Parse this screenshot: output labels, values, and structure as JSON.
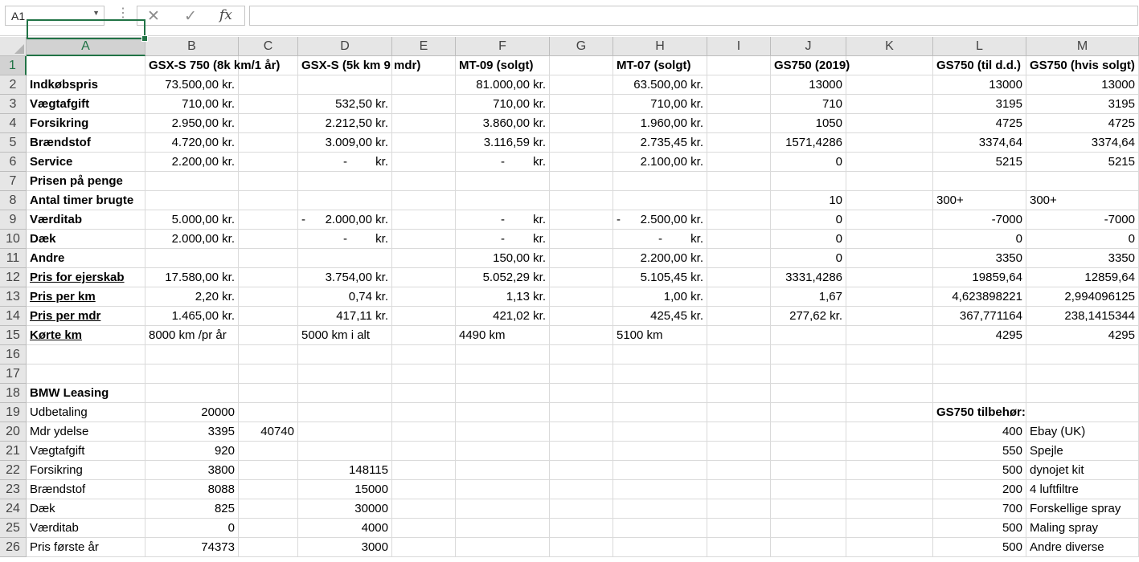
{
  "name_box": {
    "value": "A1",
    "dropdown_icon": "chevron-down-icon"
  },
  "formula_bar": {
    "cancel_icon": "✕",
    "enter_icon": "✓",
    "fx_label": "fx",
    "value": ""
  },
  "columns": [
    "A",
    "B",
    "C",
    "D",
    "E",
    "F",
    "G",
    "H",
    "I",
    "J",
    "K",
    "L",
    "M"
  ],
  "rows": [
    [
      "",
      "GSX-S 750 (8k km/1 år)",
      "",
      "GSX-S (5k km 9 mdr)",
      "",
      "MT-09 (solgt)",
      "",
      "MT-07 (solgt)",
      "",
      "GS750 (2019)",
      "",
      "GS750 (til d.d.)",
      "GS750 (hvis solgt)"
    ],
    [
      "Indkøbspris",
      "73.500,00 kr.",
      "",
      "",
      "",
      "81.000,00 kr.",
      "",
      "63.500,00 kr.",
      "",
      "13000",
      "",
      "13000",
      "13000"
    ],
    [
      "Vægtafgift",
      "710,00 kr.",
      "",
      "532,50 kr.",
      "",
      "710,00 kr.",
      "",
      "710,00 kr.",
      "",
      "710",
      "",
      "3195",
      "3195"
    ],
    [
      "Forsikring",
      "2.950,00 kr.",
      "",
      "2.212,50 kr.",
      "",
      "3.860,00 kr.",
      "",
      "1.960,00 kr.",
      "",
      "1050",
      "",
      "4725",
      "4725"
    ],
    [
      "Brændstof",
      "4.720,00 kr.",
      "",
      "3.009,00 kr.",
      "",
      "3.116,59 kr.",
      "",
      "2.735,45 kr.",
      "",
      "1571,4286",
      "",
      "3374,64",
      "3374,64"
    ],
    [
      "Service",
      "2.200,00 kr.",
      "",
      "- kr.",
      "",
      "- kr.",
      "",
      "2.100,00 kr.",
      "",
      "0",
      "",
      "5215",
      "5215"
    ],
    [
      "Prisen på penge",
      "",
      "",
      "",
      "",
      "",
      "",
      "",
      "",
      "",
      "",
      "",
      ""
    ],
    [
      "Antal timer brugte",
      "",
      "",
      "",
      "",
      "",
      "",
      "",
      "",
      "10",
      "",
      "300+",
      "300+"
    ],
    [
      "Værditab",
      "5.000,00 kr.",
      "",
      "- 2.000,00 kr.",
      "",
      "- kr.",
      "",
      "- 2.500,00 kr.",
      "",
      "0",
      "",
      "-7000",
      "-7000"
    ],
    [
      "Dæk",
      "2.000,00 kr.",
      "",
      "- kr.",
      "",
      "- kr.",
      "",
      "- kr.",
      "",
      "0",
      "",
      "0",
      "0"
    ],
    [
      "Andre",
      "",
      "",
      "",
      "",
      "150,00 kr.",
      "",
      "2.200,00 kr.",
      "",
      "0",
      "",
      "3350",
      "3350"
    ],
    [
      "Pris for ejerskab",
      "17.580,00 kr.",
      "",
      "3.754,00 kr.",
      "",
      "5.052,29 kr.",
      "",
      "5.105,45 kr.",
      "",
      "3331,4286",
      "",
      "19859,64",
      "12859,64"
    ],
    [
      "Pris per km",
      "2,20 kr.",
      "",
      "0,74 kr.",
      "",
      "1,13 kr.",
      "",
      "1,00 kr.",
      "",
      "1,67",
      "",
      "4,623898221",
      "2,994096125"
    ],
    [
      "Pris per mdr",
      "1.465,00 kr.",
      "",
      "417,11 kr.",
      "",
      "421,02 kr.",
      "",
      "425,45 kr.",
      "",
      "277,62 kr.",
      "",
      "367,771164",
      "238,1415344"
    ],
    [
      "Kørte km",
      "8000 km /pr år",
      "",
      "5000 km i alt",
      "",
      "4490 km",
      "",
      "5100 km",
      "",
      "",
      "",
      "4295",
      "4295"
    ],
    [
      "",
      "",
      "",
      "",
      "",
      "",
      "",
      "",
      "",
      "",
      "",
      "",
      ""
    ],
    [
      "",
      "",
      "",
      "",
      "",
      "",
      "",
      "",
      "",
      "",
      "",
      "",
      ""
    ],
    [
      "BMW Leasing",
      "",
      "",
      "",
      "",
      "",
      "",
      "",
      "",
      "",
      "",
      "",
      ""
    ],
    [
      "Udbetaling",
      "20000",
      "",
      "",
      "",
      "",
      "",
      "",
      "",
      "",
      "",
      "GS750 tilbehør:",
      ""
    ],
    [
      "Mdr ydelse",
      "3395",
      "40740",
      "",
      "",
      "",
      "",
      "",
      "",
      "",
      "",
      "400",
      "Ebay (UK)"
    ],
    [
      "Vægtafgift",
      "920",
      "",
      "",
      "",
      "",
      "",
      "",
      "",
      "",
      "",
      "550",
      "Spejle"
    ],
    [
      "Forsikring",
      "3800",
      "",
      "148115",
      "",
      "",
      "",
      "",
      "",
      "",
      "",
      "500",
      "dynojet kit"
    ],
    [
      "Brændstof",
      "8088",
      "",
      "15000",
      "",
      "",
      "",
      "",
      "",
      "",
      "",
      "200",
      "4 luftfiltre"
    ],
    [
      "Dæk",
      "825",
      "",
      "30000",
      "",
      "",
      "",
      "",
      "",
      "",
      "",
      "700",
      "Forskellige spray"
    ],
    [
      "Værditab",
      "0",
      "",
      "4000",
      "",
      "",
      "",
      "",
      "",
      "",
      "",
      "500",
      "Maling spray"
    ],
    [
      "Pris første år",
      "74373",
      "",
      "3000",
      "",
      "",
      "",
      "",
      "",
      "",
      "",
      "500",
      "Andre diverse"
    ]
  ],
  "colors": {
    "selection": "#217346",
    "header_bg": "#e6e6e6",
    "gridline": "#dadada"
  }
}
